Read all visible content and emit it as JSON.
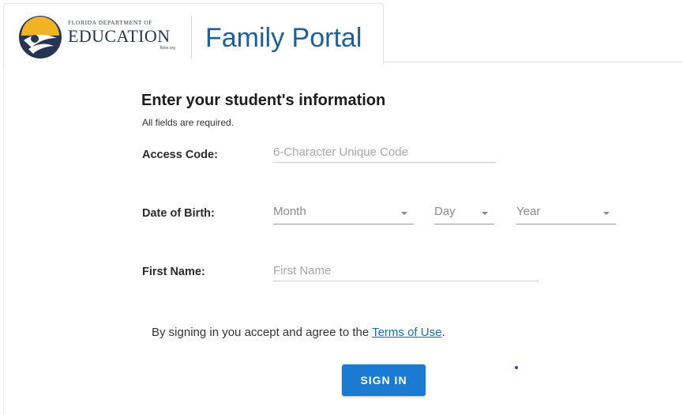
{
  "header": {
    "logo": {
      "small_text": "Florida Department of",
      "big_text": "EDUCATION",
      "tag_text": "fldoe.org"
    },
    "title": "Family Portal"
  },
  "form": {
    "heading": "Enter your student's information",
    "note": "All fields are required.",
    "access_code": {
      "label": "Access Code:",
      "placeholder": "6-Character Unique Code",
      "value": ""
    },
    "date_of_birth": {
      "label": "Date of Birth:",
      "month": "Month",
      "day": "Day",
      "year": "Year"
    },
    "first_name": {
      "label": "First Name:",
      "placeholder": "First Name",
      "value": ""
    },
    "terms": {
      "prefix": "By signing in you accept and agree to the ",
      "link": "Terms of Use",
      "suffix": "."
    },
    "sign_in_label": "SIGN IN"
  },
  "colors": {
    "title_blue": "#1f5f93",
    "button_blue": "#1b7bd3",
    "link_blue": "#1f6cb0",
    "logo_gold": "#f0b323",
    "logo_navy": "#263552"
  },
  "icons": {
    "logo": "fldoe-sun-logo-icon",
    "dropdown": "caret-down-icon"
  }
}
